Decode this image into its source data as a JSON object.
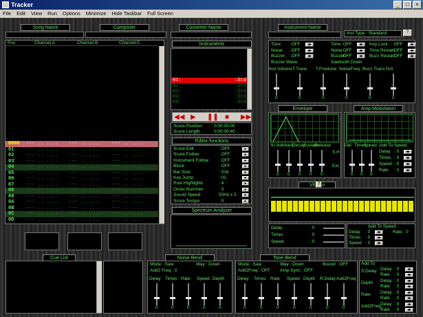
{
  "window": {
    "title": "Tracker"
  },
  "menu": [
    "File",
    "Edit",
    "View",
    "Run",
    "Options",
    "Minimize",
    "Hide Taskbar",
    "Full Screen"
  ],
  "labels": {
    "song_name": "Song Name",
    "composer": "Composer",
    "converter_name": "Converter Name",
    "instrument_name": "Instrument Name",
    "instruments": "Instruments",
    "editor_functions": "Editor functions",
    "spectrum_analyzer": "Spectrum Analyzer",
    "envelope": "Envelope",
    "amp_modulation": "Amp Modulation",
    "vibrato": "Vibrato",
    "cue_list": "Cue List",
    "noise_bend": "Noise Bend",
    "tone_bend": "Tone Bend"
  },
  "pattern": {
    "headers": [
      "Pos",
      "Channel A",
      "Channel B",
      "Channel C"
    ],
    "rows": [
      {
        "num": "0000",
        "hl": true
      },
      {
        "num": "01"
      },
      {
        "num": "02"
      },
      {
        "num": "03"
      },
      {
        "num": "04"
      },
      {
        "num": "05"
      },
      {
        "num": "06"
      },
      {
        "num": "07"
      },
      {
        "num": "08"
      },
      {
        "num": "09"
      },
      {
        "num": "0A"
      },
      {
        "num": "0B"
      },
      {
        "num": "0C"
      },
      {
        "num": "0D"
      }
    ]
  },
  "instruments": {
    "list": [
      {
        "id": "01:",
        "type": ":Std",
        "sel": true
      },
      {
        "id": "02:",
        "type": ":Std"
      },
      {
        "id": "03:",
        "type": ":Std"
      },
      {
        "id": "04:",
        "type": ":Std"
      },
      {
        "id": "05:",
        "type": ":Std"
      }
    ]
  },
  "score": {
    "position_label": "Score Position",
    "position_value": "0:00:00:00",
    "length_label": "Score Length",
    "length_value": "0:00:00:40"
  },
  "editor": [
    {
      "k": "Score Edit",
      "v": ": OFF"
    },
    {
      "k": "Score Follow",
      "v": ": OFF"
    },
    {
      "k": "Instrument Follow",
      "v": ": OFF"
    },
    {
      "k": "Block",
      "v": ": OFF"
    },
    {
      "k": "Bar Size",
      "v": ": 016"
    },
    {
      "k": "Key Jump",
      "v": ": 01"
    },
    {
      "k": "Row Highlights",
      "v": ": 4"
    },
    {
      "k": "Octav Nummer",
      "v": ": 3"
    },
    {
      "k": "Sound Speed",
      "v": "50Hz x 5"
    },
    {
      "k": "Score Tempo",
      "v": ": 0"
    }
  ],
  "inst": {
    "type_label": "Inst Type :",
    "type_value": "Standard",
    "left": [
      {
        "k": "Tone",
        "v": ": OFF"
      },
      {
        "k": "Noise",
        "v": ": OFF"
      },
      {
        "k": "Buzzer",
        "v": ": OFF"
      },
      {
        "k": "Buzzer Wave",
        "v": ""
      }
    ],
    "mid": [
      {
        "k": "Tone",
        "v": ": OFF"
      },
      {
        "k": "Noise",
        "v": ": OFF"
      },
      {
        "k": "Buzzer",
        "v": ": OFF"
      },
      {
        "k": "Sawtooth Down",
        "v": ""
      }
    ],
    "right": [
      {
        "k": "Key Lock",
        "v": ": OFF"
      },
      {
        "k": "Tone Restart",
        "v": ": OFF"
      },
      {
        "k": "Buzz Restart",
        "v": ": OFF"
      }
    ],
    "sliders": [
      "Inst Volume",
      "T.Trans",
      "T.Finetune",
      "NoiseFreq",
      "Buzz Trans",
      "N/A"
    ],
    "zero": "0"
  },
  "env": {
    "labels": [
      "St Vol",
      "Attack",
      "Decay",
      "Sustain",
      "Release"
    ],
    "sh": "S.H",
    "ext": "Ext"
  },
  "amp": {
    "labels": [
      "Del",
      "Times",
      "Speed"
    ],
    "add_to_speed": "Add To Speed",
    "rows": [
      {
        "k": "Delay",
        "v": ": 0"
      },
      {
        "k": "Times",
        "v": ": 0"
      },
      {
        "k": "Speed",
        "v": ": 0"
      },
      {
        "k": "Rate",
        "v": ": 0"
      }
    ]
  },
  "vib": {
    "rows": [
      {
        "k": "Delay",
        "v": ": 0"
      },
      {
        "k": "Times",
        "v": ": 0"
      },
      {
        "k": "Speed",
        "v": ": 0"
      }
    ],
    "add_to_speed": "Add To Speed",
    "right": [
      {
        "k": "Delay",
        "v": ": 0"
      },
      {
        "k": "Times",
        "v": ": 0"
      },
      {
        "k": "Speed",
        "v": ": 0"
      }
    ],
    "rate": "Rate :",
    "rate_v": "0"
  },
  "noise": {
    "mode": "Mode : Saw",
    "way": "Way : Down",
    "addfreq": "Add2 Freq :",
    "addfreq_v": "0",
    "sliders": [
      "Delay",
      "Times",
      "Rate",
      "Speed",
      "Depth"
    ]
  },
  "tone": {
    "mode": "Mode : Saw",
    "way": "Way : Down",
    "bound": "Bound : OFF",
    "addfreq": "Add2Freq : OFF",
    "ampsync": "Amp Sync : OFF",
    "sliders": [
      "Delay",
      "Times",
      "Rate",
      "Speed",
      "Depth",
      "R.Delay",
      "Add2Freq"
    ]
  },
  "addto": {
    "title": "Add To",
    "groups": [
      {
        "name": "S.Delay",
        "rows": [
          {
            "k": "Delay",
            "v": ": 0"
          },
          {
            "k": "Rate",
            "v": ": 0"
          }
        ]
      },
      {
        "name": "Depth",
        "rows": [
          {
            "k": "Delay",
            "v": ": 0"
          },
          {
            "k": "Rate",
            "v": ": 0"
          }
        ]
      },
      {
        "name": "Rate",
        "rows": [
          {
            "k": "Delay",
            "v": ": 0"
          },
          {
            "k": "Rate",
            "v": ": 0"
          }
        ]
      },
      {
        "name": "Add2Freq",
        "rows": [
          {
            "k": "Delay",
            "v": ": 0"
          },
          {
            "k": "Rate",
            "v": ": 0"
          }
        ]
      }
    ]
  }
}
